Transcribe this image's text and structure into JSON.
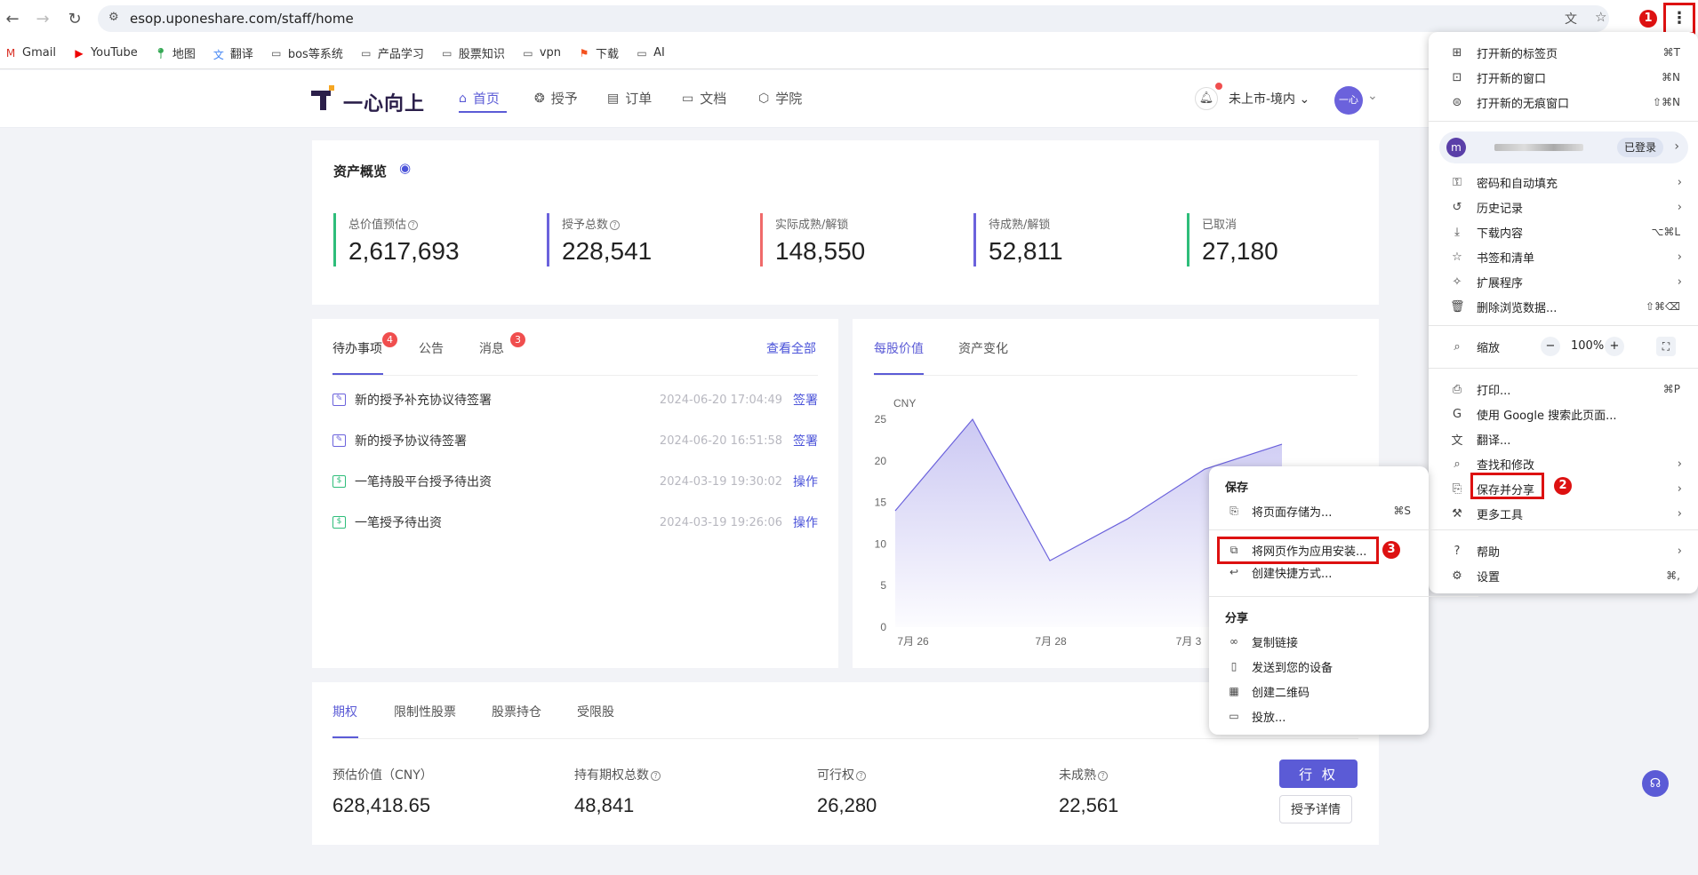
{
  "browser": {
    "url": "esop.uponeshare.com/staff/home",
    "bookmarks": [
      {
        "label": "Gmail",
        "icon": "gmail-icon"
      },
      {
        "label": "YouTube",
        "icon": "youtube-icon"
      },
      {
        "label": "地图",
        "icon": "maps-icon"
      },
      {
        "label": "翻译",
        "icon": "translate-icon"
      },
      {
        "label": "bos等系统",
        "icon": "folder-icon"
      },
      {
        "label": "产品学习",
        "icon": "folder-icon"
      },
      {
        "label": "股票知识",
        "icon": "folder-icon"
      },
      {
        "label": "vpn",
        "icon": "folder-icon"
      },
      {
        "label": "下载",
        "icon": "download-flag-icon"
      },
      {
        "label": "AI",
        "icon": "folder-icon"
      }
    ]
  },
  "app": {
    "logo_text": "一心向上",
    "nav": [
      {
        "label": "首页",
        "icon": "home-icon",
        "active": true
      },
      {
        "label": "授予",
        "icon": "award-icon",
        "active": false
      },
      {
        "label": "订单",
        "icon": "order-icon",
        "active": false
      },
      {
        "label": "文档",
        "icon": "folder-icon",
        "active": false
      },
      {
        "label": "学院",
        "icon": "academy-icon",
        "active": false
      }
    ],
    "market": "未上市-境内",
    "avatar_text": "一心"
  },
  "overview": {
    "title": "资产概览",
    "stats": [
      {
        "label": "总价值预估",
        "value": "2,617,693",
        "color": "#2ebd7a",
        "help": true
      },
      {
        "label": "授予总数",
        "value": "228,541",
        "color": "#6b62dc",
        "help": true
      },
      {
        "label": "实际成熟/解锁",
        "value": "148,550",
        "color": "#f06a6a",
        "help": false
      },
      {
        "label": "待成熟/解锁",
        "value": "52,811",
        "color": "#6b62dc",
        "help": false
      },
      {
        "label": "已取消",
        "value": "27,180",
        "color": "#2ebd7a",
        "help": false
      }
    ]
  },
  "tasks": {
    "tabs": [
      {
        "label": "待办事项",
        "badge": "4"
      },
      {
        "label": "公告",
        "badge": ""
      },
      {
        "label": "消息",
        "badge": "3"
      }
    ],
    "view_all": "查看全部",
    "items": [
      {
        "title": "新的授予补充协议待签署",
        "date": "2024-06-20 17:04:49",
        "action": "签署",
        "icon_color": "#6b62dc"
      },
      {
        "title": "新的授予协议待签署",
        "date": "2024-06-20 16:51:58",
        "action": "签署",
        "icon_color": "#6b62dc"
      },
      {
        "title": "一笔持股平台授予待出资",
        "date": "2024-03-19 19:30:02",
        "action": "操作",
        "icon_color": "#2ebd7a"
      },
      {
        "title": "一笔授予待出资",
        "date": "2024-03-19 19:26:06",
        "action": "操作",
        "icon_color": "#2ebd7a"
      }
    ]
  },
  "chart_panel": {
    "tabs": [
      "每股价值",
      "资产变化"
    ],
    "unit": "CNY"
  },
  "chart_data": {
    "type": "area",
    "ylabel": "CNY",
    "yticks": [
      0,
      5,
      10,
      15,
      20,
      25
    ],
    "ylim": [
      0,
      25
    ],
    "xtick_labels": [
      "7月 26",
      "7月 28",
      "7月 3"
    ],
    "x": [
      0,
      1,
      2,
      3,
      4,
      5
    ],
    "values": [
      14,
      25,
      8,
      13,
      19,
      22
    ],
    "color": "#6b62dc"
  },
  "equity": {
    "tabs": [
      "期权",
      "限制性股票",
      "股票持仓",
      "受限股"
    ],
    "metrics": [
      {
        "label": "预估价值（CNY）",
        "value": "628,418.65",
        "help": false
      },
      {
        "label": "持有期权总数",
        "value": "48,841",
        "help": true
      },
      {
        "label": "可行权",
        "value": "26,280",
        "help": true
      },
      {
        "label": "未成熟",
        "value": "22,561",
        "help": true
      }
    ],
    "exercise_button": "行 权",
    "detail_button": "授予详情"
  },
  "chrome_menu": {
    "items": [
      {
        "label": "打开新的标签页",
        "shortcut": "⌘T",
        "icon": "new-tab-icon"
      },
      {
        "label": "打开新的窗口",
        "shortcut": "⌘N",
        "icon": "new-window-icon"
      },
      {
        "label": "打开新的无痕窗口",
        "shortcut": "⇧⌘N",
        "icon": "incognito-icon"
      }
    ],
    "profile": {
      "initial": "m",
      "status": "已登录"
    },
    "items2": [
      {
        "label": "密码和自动填充",
        "shortcut": "",
        "icon": "key-icon",
        "arrow": true
      },
      {
        "label": "历史记录",
        "shortcut": "",
        "icon": "history-icon",
        "arrow": true
      },
      {
        "label": "下载内容",
        "shortcut": "⌥⌘L",
        "icon": "download-icon",
        "arrow": false
      },
      {
        "label": "书签和清单",
        "shortcut": "",
        "icon": "star-icon",
        "arrow": true
      },
      {
        "label": "扩展程序",
        "shortcut": "",
        "icon": "extension-icon",
        "arrow": true
      },
      {
        "label": "删除浏览数据...",
        "shortcut": "⇧⌘⌫",
        "icon": "trash-icon",
        "arrow": false
      }
    ],
    "zoom": {
      "label": "缩放",
      "value": "100%",
      "minus": "−",
      "plus": "+"
    },
    "items3": [
      {
        "label": "打印...",
        "shortcut": "⌘P",
        "icon": "print-icon",
        "arrow": false
      },
      {
        "label": "使用 Google 搜索此页面...",
        "shortcut": "",
        "icon": "google-icon",
        "arrow": false
      },
      {
        "label": "翻译...",
        "shortcut": "",
        "icon": "translate-icon",
        "arrow": false
      },
      {
        "label": "查找和修改",
        "shortcut": "",
        "icon": "find-icon",
        "arrow": true
      },
      {
        "label": "保存并分享",
        "shortcut": "",
        "icon": "save-share-icon",
        "arrow": true
      },
      {
        "label": "更多工具",
        "shortcut": "",
        "icon": "tools-icon",
        "arrow": true
      }
    ],
    "items4": [
      {
        "label": "帮助",
        "shortcut": "",
        "icon": "help-icon",
        "arrow": true
      },
      {
        "label": "设置",
        "shortcut": "⌘,",
        "icon": "settings-icon",
        "arrow": false
      }
    ]
  },
  "submenu": {
    "save_header": "保存",
    "save_page": {
      "label": "将页面存储为...",
      "shortcut": "⌘S"
    },
    "install_app": "将网页作为应用安装...",
    "shortcut": "创建快捷方式...",
    "share_header": "分享",
    "share_items": [
      {
        "label": "复制链接",
        "icon": "link-icon"
      },
      {
        "label": "发送到您的设备",
        "icon": "devices-icon"
      },
      {
        "label": "创建二维码",
        "icon": "qrcode-icon"
      },
      {
        "label": "投放...",
        "icon": "cast-icon"
      }
    ]
  },
  "annotations": [
    "1",
    "2",
    "3"
  ]
}
